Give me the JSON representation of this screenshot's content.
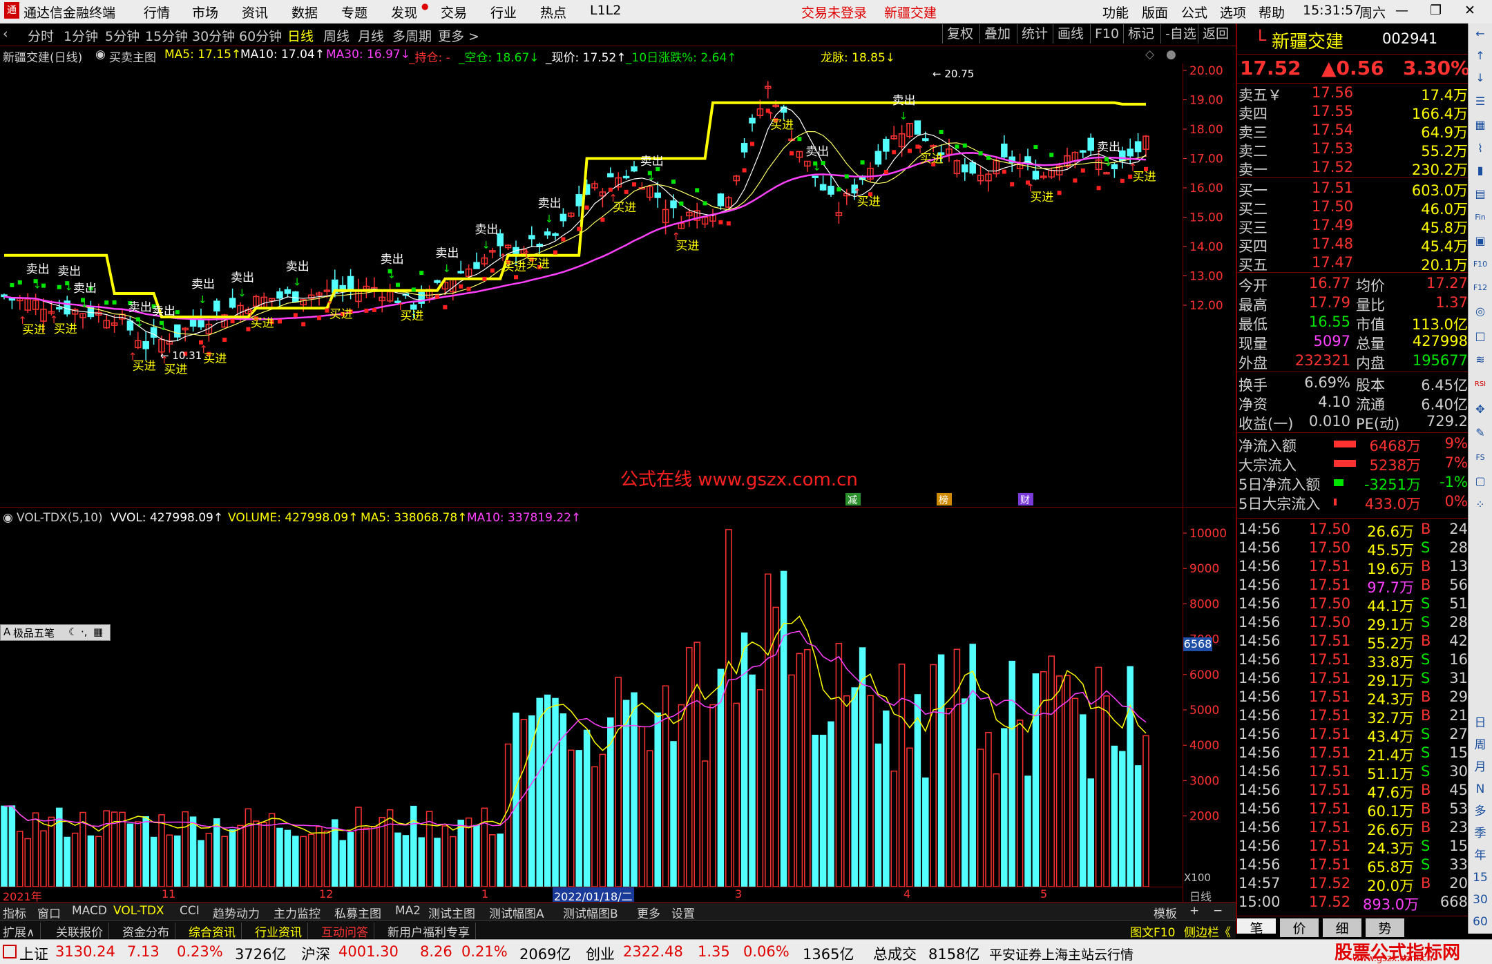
{
  "app": {
    "logo_title": "通达信金融终端",
    "menu": [
      "行情",
      "市场",
      "资讯",
      "数据",
      "专题",
      "发现",
      "交易",
      "行业",
      "热点",
      "L1L2"
    ],
    "login_status": "交易未登录",
    "stock_title": "新疆交建",
    "right_menu": [
      "功能",
      "版面",
      "公式",
      "选项",
      "帮助"
    ],
    "time": "15:31:57",
    "weekday": "周六"
  },
  "period_bar": {
    "items": [
      "分时",
      "1分钟",
      "5分钟",
      "15分钟",
      "30分钟",
      "60分钟",
      "日线",
      "周线",
      "月线",
      "多周期",
      "更多 >"
    ],
    "selected": "日线",
    "right_buttons": [
      "复权",
      "叠加",
      "统计",
      "画线",
      "F10",
      "标记",
      "-自选",
      "返回"
    ]
  },
  "main_info": {
    "stock": "新疆交建(日线)",
    "indicator": "买卖主图",
    "ma5": "MA5: 17.15↑",
    "ma10": "MA10: 17.04↑",
    "ma30": "MA30: 16.97↓",
    "chicang": "_持仓: -",
    "kongcang": "_空仓: 18.67↓",
    "xianjia": "_现价: 17.52↑",
    "zhangdie": "_10日涨跌%: 2.64↑",
    "longmai": "龙脉: 18.85↓"
  },
  "price_axis": [
    "20.00",
    "19.00",
    "18.00",
    "17.00",
    "16.00",
    "15.00",
    "14.00",
    "13.00",
    "12.00"
  ],
  "chart_labels": {
    "buy": "买进",
    "sell": "卖出",
    "high_mark": "← 20.75",
    "low_mark": "← 10.31",
    "watermark": "公式在线  www.gszx.com.cn",
    "events": [
      "减",
      "榜",
      "财"
    ]
  },
  "vol_info": {
    "name": "VOL-TDX(5,10)",
    "vvol": "VVOL: 427998.09↑",
    "volume": "VOLUME: 427998.09↑",
    "ma5": "MA5: 338068.78↑",
    "ma10": "MA10: 337819.22↑"
  },
  "vol_axis": [
    "10000",
    "9000",
    "8000",
    "7000",
    "6000",
    "5000",
    "4000",
    "3000",
    "2000"
  ],
  "vol_current": "6568",
  "vol_unit": "X100",
  "tool_label": "极品五笔",
  "x_axis": {
    "labels": [
      "2021年",
      "11",
      "12",
      "1",
      "2022/01/18/二",
      "3",
      "4",
      "5"
    ],
    "right_label": "日线"
  },
  "right_panel": {
    "code_prefix": "L",
    "name": "新疆交建",
    "code": "002941",
    "price": "17.52",
    "change": "▲0.56",
    "pct": "3.30%",
    "asks": [
      {
        "label": "卖五￥",
        "price": "17.56",
        "vol": "17.4万"
      },
      {
        "label": "卖四",
        "price": "17.55",
        "vol": "166.4万"
      },
      {
        "label": "卖三",
        "price": "17.54",
        "vol": "64.9万"
      },
      {
        "label": "卖二",
        "price": "17.53",
        "vol": "55.2万"
      },
      {
        "label": "卖一",
        "price": "17.52",
        "vol": "230.2万"
      }
    ],
    "bids": [
      {
        "label": "买一",
        "price": "17.51",
        "vol": "603.0万"
      },
      {
        "label": "买二",
        "price": "17.50",
        "vol": "46.0万"
      },
      {
        "label": "买三",
        "price": "17.49",
        "vol": "45.8万"
      },
      {
        "label": "买四",
        "price": "17.48",
        "vol": "45.4万"
      },
      {
        "label": "买五",
        "price": "17.47",
        "vol": "20.1万"
      }
    ],
    "stats": [
      {
        "l1": "今开",
        "v1": "16.77",
        "l2": "均价",
        "v2": "17.27"
      },
      {
        "l1": "最高",
        "v1": "17.79",
        "l2": "量比",
        "v2": "1.37"
      },
      {
        "l1": "最低",
        "v1": "16.55",
        "l2": "市值",
        "v2": "113.0亿"
      },
      {
        "l1": "现量",
        "v1": "5097",
        "l2": "总量",
        "v2": "427998"
      },
      {
        "l1": "外盘",
        "v1": "232321",
        "l2": "内盘",
        "v2": "195677"
      }
    ],
    "stats2": [
      {
        "l1": "换手",
        "v1": "6.69%",
        "l2": "股本",
        "v2": "6.45亿"
      },
      {
        "l1": "净资",
        "v1": "4.10",
        "l2": "流通",
        "v2": "6.40亿"
      },
      {
        "l1": "收益(一)",
        "v1": "0.010",
        "l2": "PE(动)",
        "v2": "729.2"
      }
    ],
    "flows": [
      {
        "label": "净流入额",
        "value": "6468万",
        "pct": "9%"
      },
      {
        "label": "大宗流入",
        "value": "5238万",
        "pct": "7%"
      },
      {
        "label": "5日净流入额",
        "value": "-3251万",
        "pct": "-1%"
      },
      {
        "label": "5日大宗流入",
        "value": "433.0万",
        "pct": "0%"
      }
    ],
    "ticks": [
      {
        "t": "14:56",
        "p": "17.50",
        "v": "26.6万",
        "d": "B",
        "n": "24"
      },
      {
        "t": "14:56",
        "p": "17.50",
        "v": "45.5万",
        "d": "S",
        "n": "28"
      },
      {
        "t": "14:56",
        "p": "17.51",
        "v": "19.6万",
        "d": "B",
        "n": "13"
      },
      {
        "t": "14:56",
        "p": "17.51",
        "v": "97.7万",
        "d": "B",
        "n": "56"
      },
      {
        "t": "14:56",
        "p": "17.50",
        "v": "44.1万",
        "d": "S",
        "n": "51"
      },
      {
        "t": "14:56",
        "p": "17.50",
        "v": "29.1万",
        "d": "S",
        "n": "28"
      },
      {
        "t": "14:56",
        "p": "17.51",
        "v": "55.2万",
        "d": "B",
        "n": "42"
      },
      {
        "t": "14:56",
        "p": "17.51",
        "v": "33.8万",
        "d": "S",
        "n": "16"
      },
      {
        "t": "14:56",
        "p": "17.51",
        "v": "29.1万",
        "d": "S",
        "n": "31"
      },
      {
        "t": "14:56",
        "p": "17.51",
        "v": "24.3万",
        "d": "B",
        "n": "29"
      },
      {
        "t": "14:56",
        "p": "17.51",
        "v": "32.7万",
        "d": "B",
        "n": "21"
      },
      {
        "t": "14:56",
        "p": "17.51",
        "v": "43.4万",
        "d": "S",
        "n": "27"
      },
      {
        "t": "14:56",
        "p": "17.51",
        "v": "21.4万",
        "d": "S",
        "n": "15"
      },
      {
        "t": "14:56",
        "p": "17.51",
        "v": "51.1万",
        "d": "S",
        "n": "30"
      },
      {
        "t": "14:56",
        "p": "17.51",
        "v": "47.6万",
        "d": "B",
        "n": "45"
      },
      {
        "t": "14:56",
        "p": "17.51",
        "v": "60.1万",
        "d": "B",
        "n": "53"
      },
      {
        "t": "14:56",
        "p": "17.51",
        "v": "26.6万",
        "d": "B",
        "n": "23"
      },
      {
        "t": "14:56",
        "p": "17.51",
        "v": "24.3万",
        "d": "S",
        "n": "15"
      },
      {
        "t": "14:56",
        "p": "17.51",
        "v": "65.8万",
        "d": "S",
        "n": "33"
      },
      {
        "t": "14:57",
        "p": "17.52",
        "v": "20.0万",
        "d": "B",
        "n": "20"
      },
      {
        "t": "15:00",
        "p": "17.52",
        "v": "893.0万",
        "d": "",
        "n": "668"
      }
    ],
    "bottom_tabs": [
      "笔",
      "价",
      "细",
      "势"
    ]
  },
  "icon_strip": [
    "日",
    "周",
    "月",
    "N",
    "多",
    "季",
    "年",
    "15",
    "30",
    "60"
  ],
  "bottom_tabs1": [
    "指标",
    "窗口",
    "MACD",
    "VOL-TDX",
    "CCI",
    "趋势动力",
    "主力监控",
    "私募主图",
    "MA2",
    "测试主图",
    "测试幅图A",
    "测试幅图B",
    "更多",
    "设置"
  ],
  "bottom_tabs1_selected": "VOL-TDX",
  "template_label": "模板",
  "bottom_tabs2": [
    "扩展∧",
    "关联报价",
    "资金分布",
    "综合资讯",
    "行业资讯",
    "互动问答",
    "新用户福利专享"
  ],
  "bottom_tabs2_right": [
    "图文F10",
    "侧边栏《"
  ],
  "status": {
    "sh_label": "上证",
    "sh_val": "3130.24",
    "sh_chg": "7.13",
    "sh_pct": "0.23%",
    "sh_amt": "3726亿",
    "hs_label": "沪深",
    "hs_val": "4001.30",
    "hs_chg": "8.26",
    "hs_pct": "0.21%",
    "hs_amt": "2069亿",
    "cy_label": "创业",
    "cy_val": "2322.48",
    "cy_chg": "1.35",
    "cy_pct": "0.06%",
    "cy_amt": "1365亿",
    "total_label": "总成交",
    "total_val": "8158亿",
    "broker": "平安证券上海主站云行情",
    "brand": "股票公式指标网",
    "brand_url": "www.gszx.com.cn"
  },
  "colors": {
    "up": "#ff3232",
    "down": "#54ffff",
    "yellow": "#ffff00",
    "magenta": "#ff40ff",
    "green": "#00e600",
    "panel_border": "#800000"
  },
  "chart_data": {
    "type": "candlestick",
    "price_range": [
      10.31,
      20.75
    ],
    "volume_range_x100": [
      0,
      10000
    ],
    "current_volume_x100": 6568
  }
}
